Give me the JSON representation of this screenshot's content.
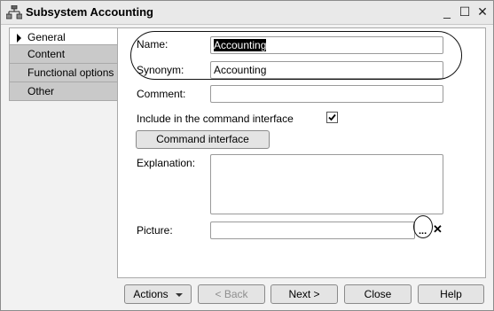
{
  "window": {
    "title": "Subsystem Accounting",
    "controls": {
      "minimize": "_",
      "maximize": "☐",
      "close": "✕"
    }
  },
  "tabs": [
    {
      "label": "General",
      "active": true
    },
    {
      "label": "Content"
    },
    {
      "label": "Functional options"
    },
    {
      "label": "Other"
    }
  ],
  "form": {
    "name_label": "Name:",
    "name_value": "Accounting",
    "synonym_label": "Synonym:",
    "synonym_value": "Accounting",
    "comment_label": "Comment:",
    "comment_value": "",
    "include_label": "Include in the command interface",
    "include_checked": true,
    "command_interface_button": "Command interface",
    "explanation_label": "Explanation:",
    "explanation_value": "",
    "picture_label": "Picture:",
    "picture_value": "",
    "picture_choose": "...",
    "picture_clear": "✕"
  },
  "footer": {
    "actions": "Actions",
    "back": "< Back",
    "next": "Next >",
    "close": "Close",
    "help": "Help"
  },
  "icons": {
    "app": "subsystem-icon",
    "tab_arrow": "triangle-right-icon",
    "check": "checkmark-icon"
  }
}
